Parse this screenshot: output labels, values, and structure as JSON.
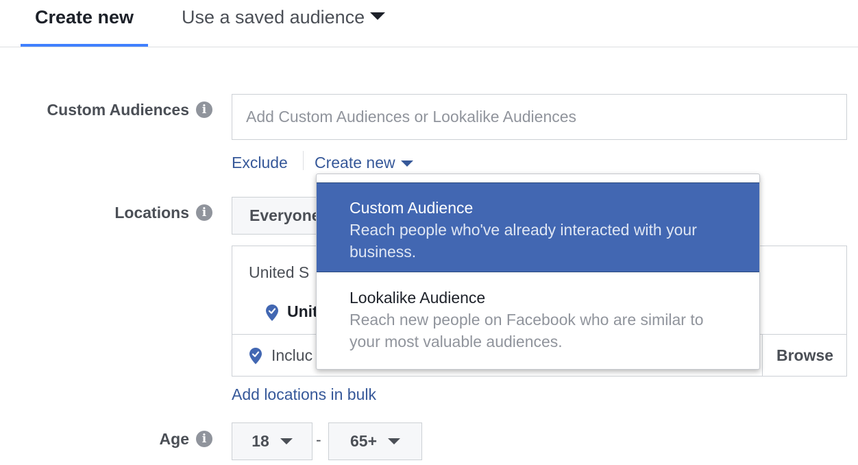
{
  "tabs": {
    "create_new": "Create new",
    "saved_audience": "Use a saved audience"
  },
  "custom_audiences": {
    "label": "Custom Audiences",
    "placeholder": "Add Custom Audiences or Lookalike Audiences",
    "exclude_link": "Exclude",
    "create_new_link": "Create new"
  },
  "dropdown": {
    "items": [
      {
        "title": "Custom Audience",
        "description": "Reach people who've already interacted with your business."
      },
      {
        "title": "Lookalike Audience",
        "description": "Reach new people on Facebook who are similar to your most valuable audiences."
      }
    ]
  },
  "locations": {
    "label": "Locations",
    "audience_button": "Everyone",
    "country_header": "United S",
    "selected_location": "Unit",
    "include_label": "Incluc",
    "browse_button": "Browse",
    "bulk_link": "Add locations in bulk"
  },
  "age": {
    "label": "Age",
    "min": "18",
    "separator": "-",
    "max": "65+"
  },
  "icons": {
    "info": "info-icon",
    "pin": "location-pin-icon",
    "caret": "caret-down-icon"
  },
  "colors": {
    "accent": "#4080ff",
    "link": "#365899",
    "menu_active": "#4267b2",
    "label": "#4b4f56",
    "muted": "#90949c"
  }
}
